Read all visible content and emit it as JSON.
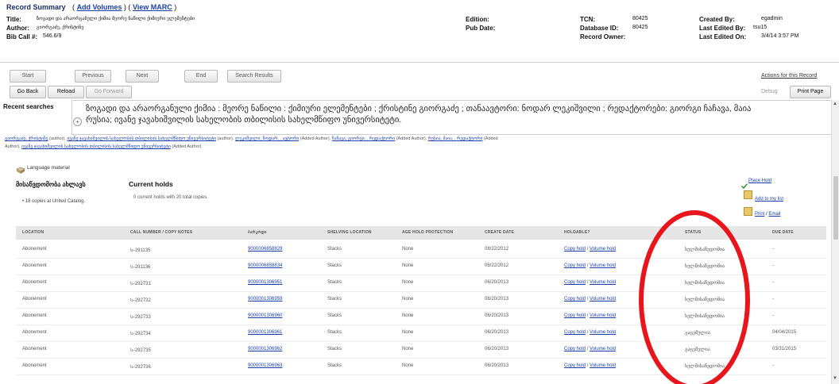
{
  "summary": {
    "heading": "Record Summary",
    "open_paren": "(",
    "add_volumes": "Add Volumes",
    "sep": ") (",
    "view_marc": "View MARC",
    "close_paren": ")",
    "title_label": "Title:",
    "title_value": "ზოგადი და არაორგანული ქიმია მეორე ნაწილი ქიმიური ელემენტები",
    "author_label": "Author:",
    "author_value": "გიორგაძე, ქრისტინე",
    "bib_call_label": "Bib Call #:",
    "bib_call_value": "546.6/9",
    "edition_label": "Edition:",
    "pub_date_label": "Pub Date:",
    "tcn_label": "TCN:",
    "tcn_value": "80425",
    "database_id_label": "Database ID:",
    "database_id_value": "80425",
    "record_owner_label": "Record Owner:",
    "created_by_label": "Created By:",
    "created_by_value": "egadmin",
    "last_edited_by_label": "Last Edited By:",
    "last_edited_by_value": "tsu15",
    "last_edited_on_label": "Last Edited On:",
    "last_edited_on_value": "3/4/14 3:57 PM"
  },
  "nav": {
    "start": "Start",
    "previous": "Previous",
    "next": "Next",
    "end": "End",
    "search_results": "Search Results",
    "go_back": "Go Back",
    "reload": "Reload",
    "go_forward": "Go Forward",
    "actions": "Actions for this Record",
    "debug": "Debug",
    "print_page": "Print Page"
  },
  "record": {
    "recent_searches": "Recent searches",
    "plus_symbol": "+",
    "title_line1": "ზოგადი და არაორგანული ქიმია : მეორე ნაწილი : ქიმიური ელემენტები ; ქრისტინე გიორგაძე ; თანაავტორი: ნოდარ ლეკიშვილი ; რედაქტორები: გიორგი ჩაჩავა, მაია",
    "title_line2": "რუსია; ივანე ჯავახიშვილის სახელობის თბილისის სახელმწიფო უნივერსიტეტი.",
    "authors": [
      {
        "name": "გიორგაძე, ქრისტინე",
        "role": "(author)."
      },
      {
        "name": "ივანე ჯავახიშვილის სახელობის თბილისის სახელმწიფო უნივერსიტეტი",
        "role": "(author)."
      },
      {
        "name": "ლეკიშვილი, ნოდარ, , ავტორი",
        "role": "(Added Author)."
      },
      {
        "name": "ჩაჩავა, გიორგი, , რედაქტორი",
        "role": "(Added Author)."
      },
      {
        "name": "რუსია, მაია, , რედაქტორი",
        "role": "(Added"
      },
      {
        "name": "",
        "role": "Author)."
      },
      {
        "name": "ივანე ჯავახიშვილის სახელობის თბილისის სახელმწიფო უნივერსიტეტი",
        "role": "(Added Author)."
      }
    ],
    "format": "Language material"
  },
  "holdings": {
    "section_title": "მისაწვდომობა ახლავს",
    "copies_line": "18 copies at United Catalog.",
    "current_holds_title": "Current holds",
    "current_holds_text": "0 current holds with 20 total copies.",
    "place_hold": "Place Hold",
    "add_to_list": "Add to my list",
    "print": "Print",
    "slash": "/",
    "email": "Email"
  },
  "table": {
    "headers": [
      "LOCATION",
      "CALL NUMBER / COPY NOTES",
      "ბარკოდი",
      "SHELVING LOCATION",
      "AGE HOLD PROTECTION",
      "CREATE DATE",
      "HOLDABLE?",
      "STATUS",
      "DUE DATE"
    ],
    "copy_hold": "Copy hold",
    "volume_hold": "Volume hold",
    "rows": [
      {
        "location": "Abonement",
        "call": "Ს-291135",
        "barcode": "9000006858829",
        "shelving": "Stacks",
        "age": "None",
        "created": "08/22/2012",
        "status": "ხელმისაწვდომია",
        "due": "-"
      },
      {
        "location": "Abonement",
        "call": "Ს-291136",
        "barcode": "9000006858834",
        "shelving": "Stacks",
        "age": "None",
        "created": "08/22/2012",
        "status": "ხელმისაწვდომია",
        "due": "-"
      },
      {
        "location": "Abonement",
        "call": "Ს-292731",
        "barcode": "9000001306951",
        "shelving": "Stacks",
        "age": "None",
        "created": "06/20/2013",
        "status": "ხელმისაწვდომია",
        "due": "-"
      },
      {
        "location": "Abonement",
        "call": "Ს-292732",
        "barcode": "9000001306959",
        "shelving": "Stacks",
        "age": "None",
        "created": "06/20/2013",
        "status": "ხელმისაწვდომია",
        "due": "-"
      },
      {
        "location": "Abonement",
        "call": "Ს-292733",
        "barcode": "9000001306960",
        "shelving": "Stacks",
        "age": "None",
        "created": "06/20/2013",
        "status": "ხელმისაწვდომია",
        "due": "-"
      },
      {
        "location": "Abonement",
        "call": "Ს-292734",
        "barcode": "9000001306961",
        "shelving": "Stacks",
        "age": "None",
        "created": "06/20/2013",
        "status": "გაცემულია",
        "due": "04/04/2015"
      },
      {
        "location": "Abonement",
        "call": "Ს-292735",
        "barcode": "9000001306962",
        "shelving": "Stacks",
        "age": "None",
        "created": "06/20/2013",
        "status": "გაცემულია",
        "due": "03/31/2015"
      },
      {
        "location": "Abonement",
        "call": "Ს-292736",
        "barcode": "9000001306963",
        "shelving": "Stacks",
        "age": "None",
        "created": "06/20/2013",
        "status": "ხელმისაწვდომია",
        "due": "-"
      }
    ]
  },
  "scrollbar": {
    "up_arrow": "▲",
    "down_arrow": "▼"
  },
  "colors": {
    "annotation_circle": "#e8161c",
    "link": "#1a3fa8",
    "header_bg": "#e6e6e6"
  }
}
